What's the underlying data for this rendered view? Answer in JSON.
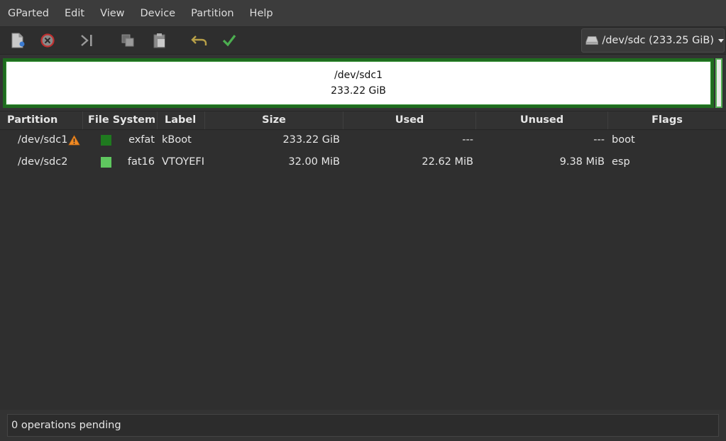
{
  "menubar": {
    "items": [
      "GParted",
      "Edit",
      "View",
      "Device",
      "Partition",
      "Help"
    ]
  },
  "toolbar": {
    "buttons": [
      {
        "name": "new-partition",
        "icon": "new-document-icon"
      },
      {
        "name": "delete-partition",
        "icon": "delete-circle-icon"
      },
      {
        "name": "resize-move",
        "icon": "resize-move-icon"
      },
      {
        "name": "copy",
        "icon": "copy-icon"
      },
      {
        "name": "paste",
        "icon": "paste-icon"
      },
      {
        "name": "undo",
        "icon": "undo-arrow-icon"
      },
      {
        "name": "apply",
        "icon": "checkmark-icon"
      }
    ],
    "device_selector": {
      "label": "/dev/sdc (233.25 GiB)",
      "icon": "drive-icon"
    }
  },
  "disk_map": {
    "name": "/dev/sdc1",
    "size": "233.22 GiB"
  },
  "table": {
    "headers": [
      "Partition",
      "File System",
      "Label",
      "Size",
      "Used",
      "Unused",
      "Flags"
    ],
    "rows": [
      {
        "partition": "/dev/sdc1",
        "warning": true,
        "fs_color": "#1f7a1f",
        "fs": "exfat",
        "label": "kBoot",
        "size": "233.22 GiB",
        "used": "---",
        "unused": "---",
        "flags": "boot"
      },
      {
        "partition": "/dev/sdc2",
        "warning": false,
        "fs_color": "#5fc75f",
        "fs": "fat16",
        "label": "VTOYEFI",
        "size": "32.00 MiB",
        "used": "22.62 MiB",
        "unused": "9.38 MiB",
        "flags": "esp"
      }
    ]
  },
  "statusbar": {
    "text": "0 operations pending"
  },
  "colors": {
    "accent_green": "#1f6b1f",
    "warning_orange": "#f08a24",
    "apply_green": "#4caf50",
    "undo_gold": "#b8a048"
  }
}
